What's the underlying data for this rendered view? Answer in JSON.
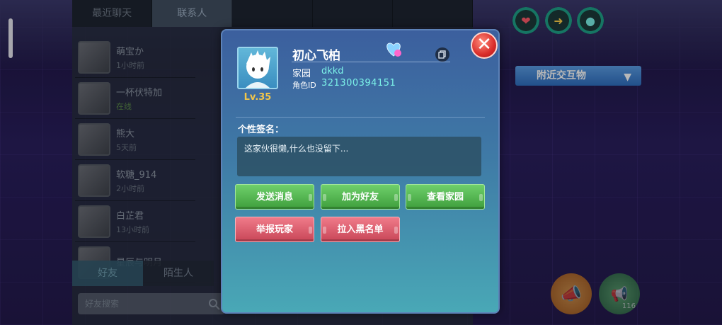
{
  "friend_panel": {
    "top_tabs": [
      "最近聊天",
      "联系人",
      "",
      "",
      ""
    ],
    "friends": [
      {
        "name": "萌宝か",
        "status": "1小时前"
      },
      {
        "name": "一杯伏特加",
        "status": "在线"
      },
      {
        "name": "熊大",
        "status": "5天前"
      },
      {
        "name": "软糖_914",
        "status": "2小时前"
      },
      {
        "name": "白芷君",
        "status": "13小时前"
      },
      {
        "name": "星辰与明月",
        "status": ""
      }
    ],
    "bottom_tabs": [
      "好友",
      "陌生人"
    ],
    "search_placeholder": "好友搜索"
  },
  "hud": {
    "nearby_label": "附近交互物",
    "action_count": "116"
  },
  "profile": {
    "name": "初心飞柏",
    "level": "Lv.35",
    "home_label": "家园",
    "home_value": "dkkd",
    "role_id_label": "角色ID",
    "role_id_value": "321300394151",
    "signature_label": "个性签名：",
    "signature_text": "这家伙很懒,什么也没留下..."
  },
  "buttons": {
    "send_message": "发送消息",
    "add_friend": "加为好友",
    "view_home": "查看家园",
    "report_player": "举报玩家",
    "blacklist": "拉入黑名单"
  },
  "colors": {
    "accent_cyan": "#7cf2e8",
    "level_gold": "#f2c54a",
    "button_green": "#4fb44c",
    "button_red": "#d65566",
    "close_red": "#d92d2a"
  }
}
